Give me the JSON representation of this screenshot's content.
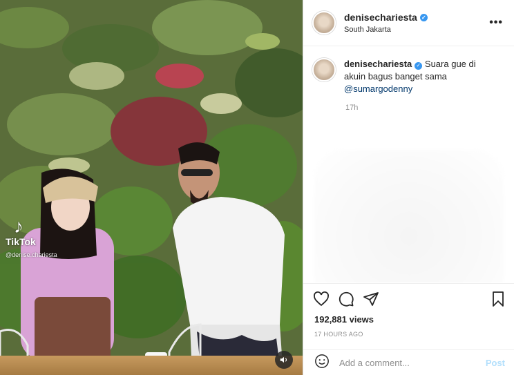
{
  "post": {
    "username": "denisechariesta",
    "location": "South Jakarta",
    "verified": true,
    "more_label": "•••",
    "caption_text": "Suara gue di akuin bagus banget sama ",
    "caption_mention": "@sumargodenny",
    "caption_time": "17h",
    "views": "192,881 views",
    "posted_ago": "17 HOURS AGO"
  },
  "media": {
    "tiktok_logo": "♪",
    "tiktok_label": "TikTok",
    "tiktok_user": "@denise.chariesta"
  },
  "comment_box": {
    "placeholder": "Add a comment...",
    "post_label": "Post"
  },
  "colors": {
    "accent": "#3897f0",
    "post_disabled": "#b2dffc",
    "mention": "#00376b"
  },
  "icons": {
    "verified": "verified-badge-icon",
    "like": "heart-icon",
    "comment": "comment-icon",
    "share": "paper-plane-icon",
    "save": "bookmark-icon",
    "emoji": "emoji-icon",
    "mute": "speaker-icon"
  }
}
